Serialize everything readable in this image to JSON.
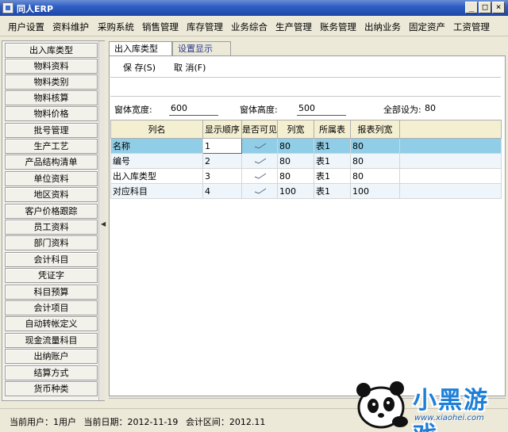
{
  "window": {
    "title": "同人ERP",
    "min": "_",
    "max": "□",
    "close": "×"
  },
  "menubar": [
    "用户设置",
    "资料维护",
    "采购系统",
    "销售管理",
    "库存管理",
    "业务综合",
    "生产管理",
    "账务管理",
    "出纳业务",
    "固定资产",
    "工资管理"
  ],
  "sidebar": {
    "items": [
      "出入库类型",
      "物料资料",
      "物料类别",
      "物料核算",
      "物料价格",
      "批号管理",
      "生产工艺",
      "产品结构清单",
      "单位资料",
      "地区资料",
      "客户价格跟踪",
      "员工资料",
      "部门资料",
      "会计科目",
      "凭证字",
      "科目预算",
      "会计项目",
      "自动转帐定义",
      "现金流量科目",
      "出纳账户",
      "结算方式",
      "货币种类"
    ]
  },
  "tabs": [
    {
      "label": "出入库类型"
    },
    {
      "label": "设置显示"
    }
  ],
  "toolbar": {
    "save_label": "保 存(S)",
    "cancel_label": "取 消(F)"
  },
  "form": {
    "width_label": "窗体宽度:",
    "width_value": "600",
    "height_label": "窗体高度:",
    "height_value": "500",
    "all_label": "全部设为:",
    "all_value": "80"
  },
  "grid": {
    "columns": [
      "列名",
      "显示顺序",
      "是否可见",
      "列宽",
      "所属表",
      "报表列宽",
      ""
    ],
    "rows": [
      {
        "name": "名称",
        "order": "1",
        "width": "80",
        "table": "表1",
        "report_width": "80"
      },
      {
        "name": "编号",
        "order": "2",
        "width": "80",
        "table": "表1",
        "report_width": "80"
      },
      {
        "name": "出入库类型",
        "order": "3",
        "width": "80",
        "table": "表1",
        "report_width": "80"
      },
      {
        "name": "对应科目",
        "order": "4",
        "width": "100",
        "table": "表1",
        "report_width": "100"
      }
    ]
  },
  "status": {
    "user": "当前用户：1用户",
    "date": "当前日期：2012-11-19",
    "period": "会计区间：2012.11"
  },
  "watermark": {
    "text": "小黑游戏",
    "url": "www.xiaohei.com"
  }
}
